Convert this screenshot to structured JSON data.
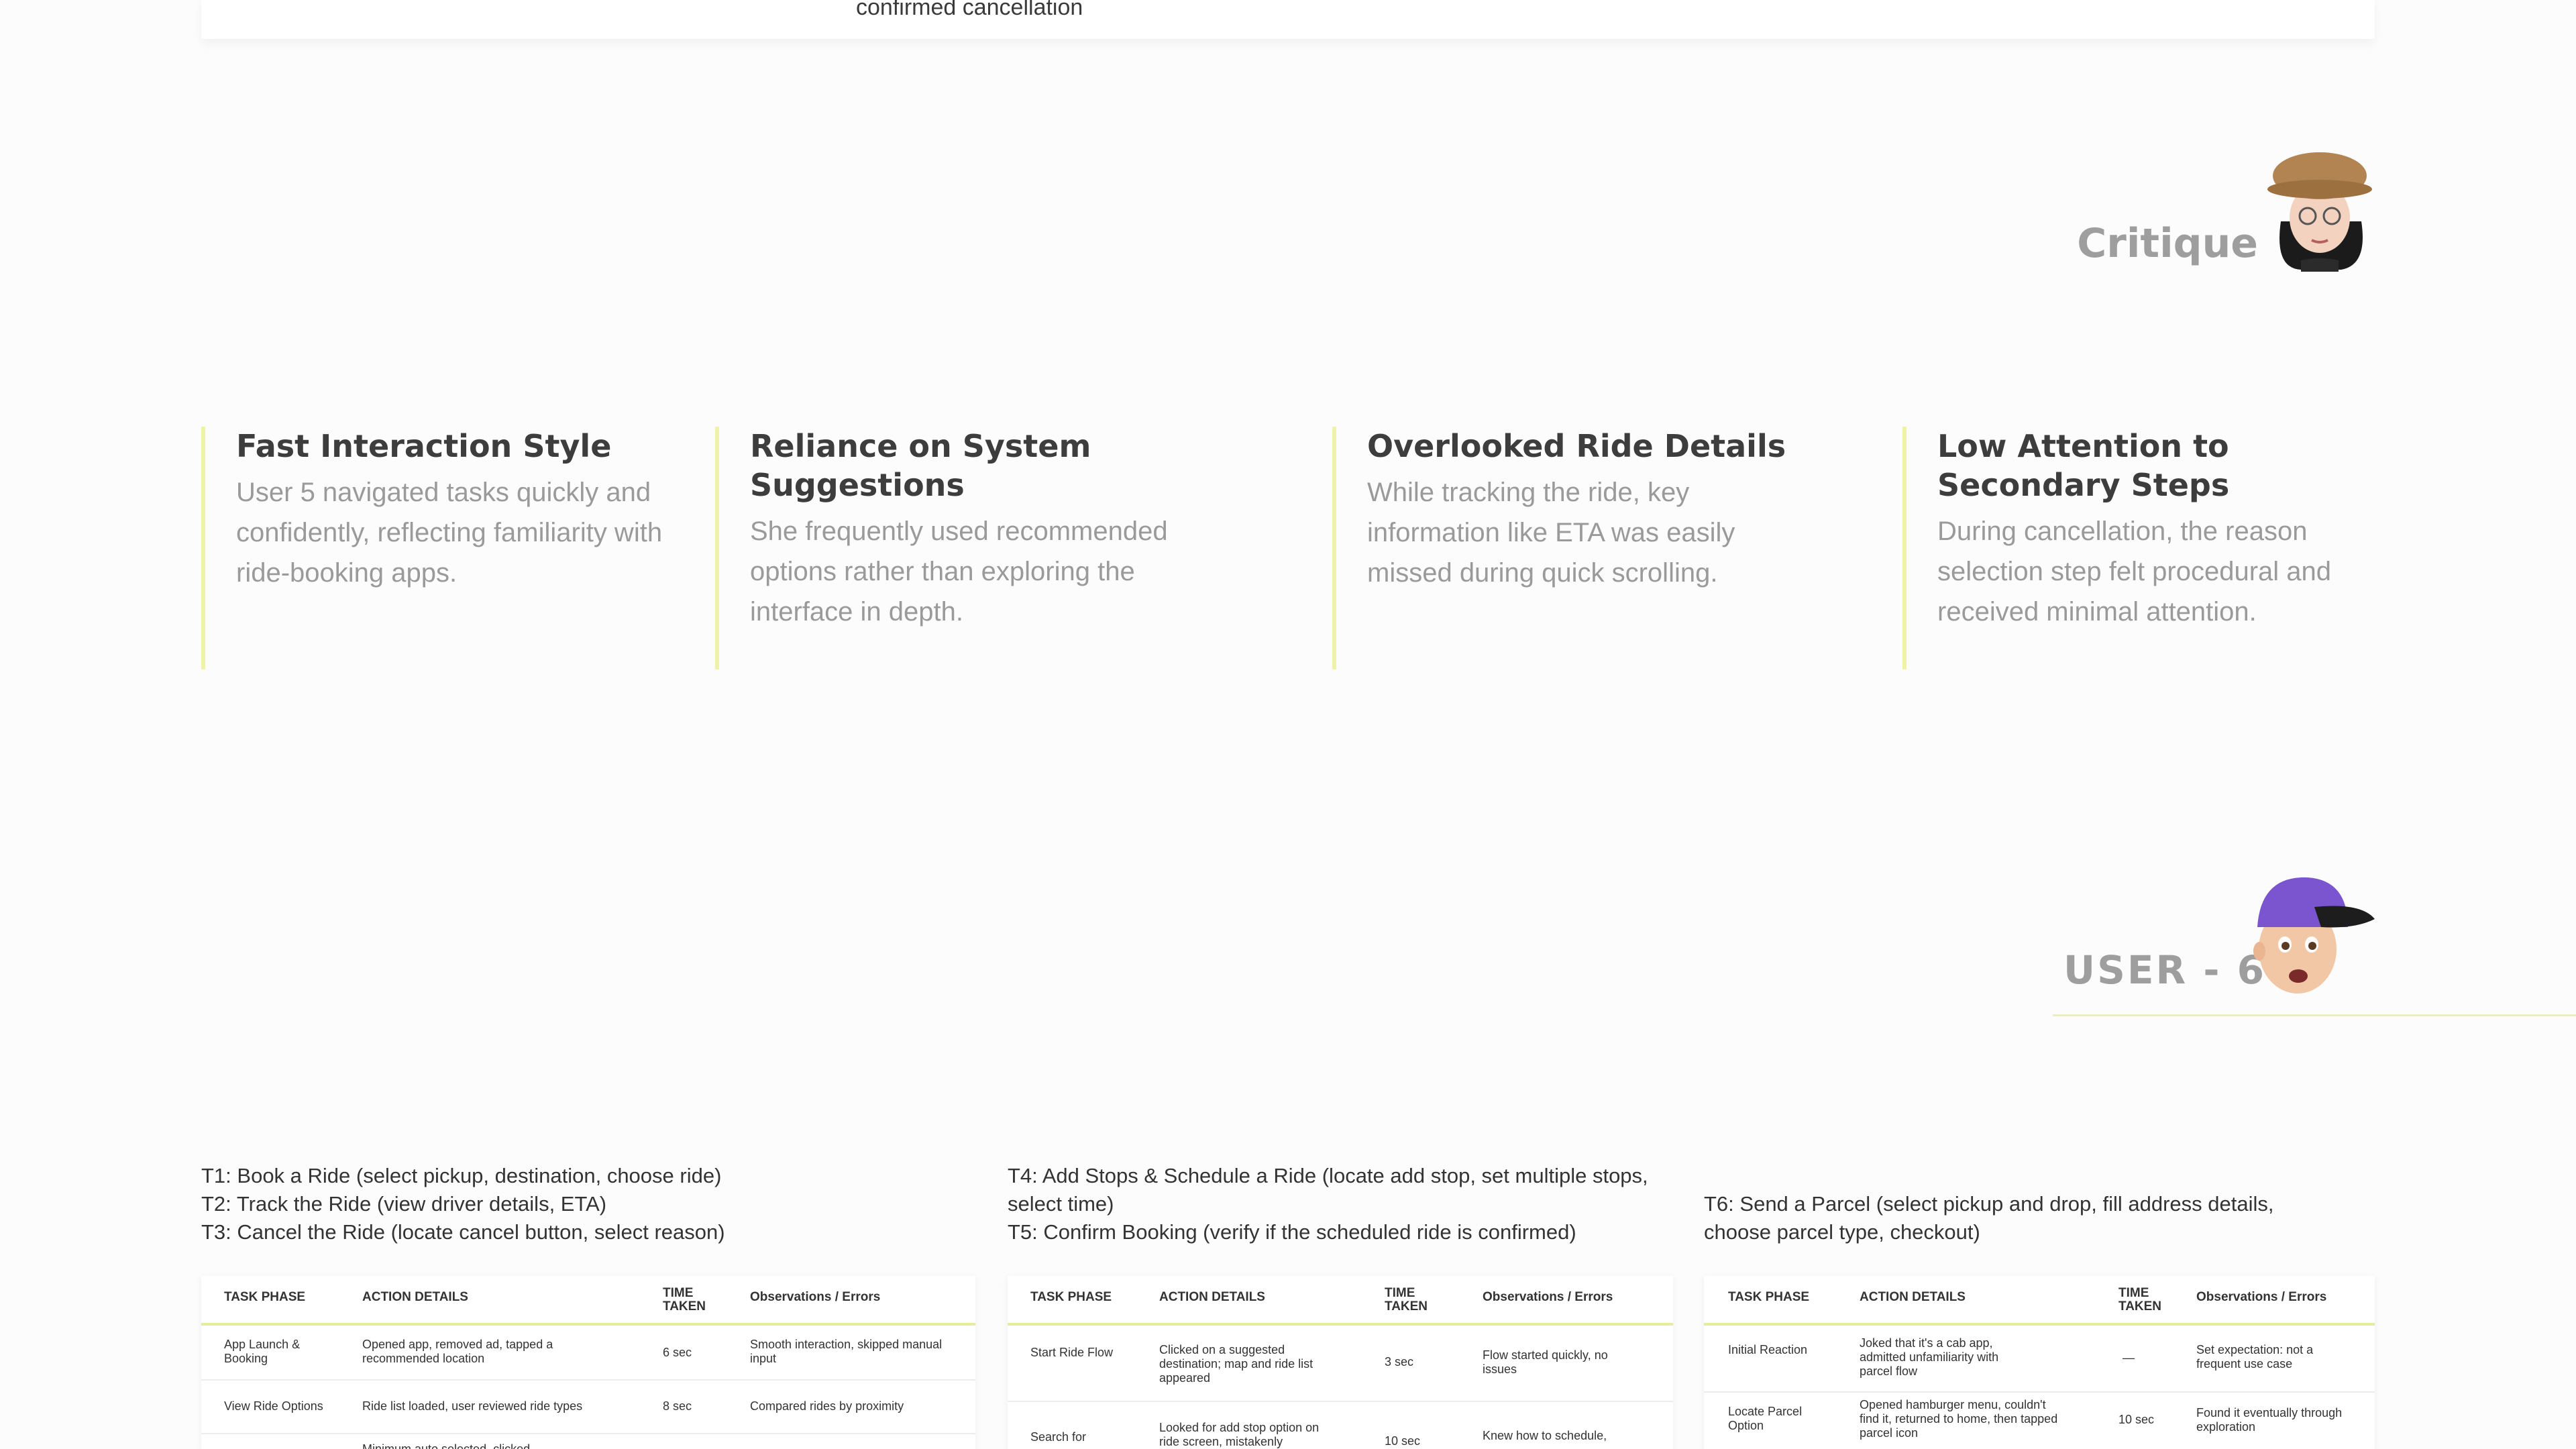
{
  "previous_card": {
    "text": "confirmed cancellation"
  },
  "critique": {
    "title": "Critique",
    "avatar_icon": "memoji-woman-hat-icon"
  },
  "insights": [
    {
      "title": "Fast Interaction Style",
      "body": "User 5 navigated tasks quickly and confidently, reflecting familiarity with ride-booking apps."
    },
    {
      "title": "Reliance on System Suggestions",
      "body": "She frequently used recommended options rather than exploring the interface in depth."
    },
    {
      "title": "Overlooked Ride Details",
      "body": "While tracking the ride, key information like ETA was easily missed during quick scrolling."
    },
    {
      "title": "Low Attention to Secondary Steps",
      "body": "During cancellation, the reason selection step felt procedural and received minimal attention."
    }
  ],
  "user_section": {
    "title": "USER - 6",
    "avatar_icon": "memoji-man-cap-icon"
  },
  "task_groups": [
    {
      "lines": [
        "T1: Book a Ride (select pickup, destination, choose ride)",
        "T2: Track the Ride (view driver details, ETA)",
        "T3: Cancel the Ride (locate cancel button, select reason)"
      ],
      "headers": [
        "TASK PHASE",
        "ACTION DETAILS",
        "TIME TAKEN",
        "Observations / Errors"
      ],
      "rows": [
        [
          "App Launch & Booking",
          "Opened app, removed ad, tapped a recommended location",
          "6 sec",
          "Smooth interaction, skipped manual input"
        ],
        [
          "View Ride Options",
          "Ride list loaded, user reviewed ride types",
          "8 sec",
          "Compared rides by proximity"
        ],
        [
          "",
          "Minimum auto selected, clicked",
          "",
          ""
        ]
      ]
    },
    {
      "lines": [
        "T4: Add Stops & Schedule a Ride (locate add stop, set multiple stops, select time)",
        "T5: Confirm Booking (verify if the scheduled ride is confirmed)"
      ],
      "headers": [
        "TASK PHASE",
        "ACTION DETAILS",
        "TIME TAKEN",
        "Observations / Errors"
      ],
      "rows": [
        [
          "Start Ride Flow",
          "Clicked on a suggested destination; map and ride list appeared",
          "3 sec",
          "Flow started quickly, no issues"
        ],
        [
          "Search for",
          "Looked for add stop option on ride screen, mistakenly",
          "10 sec",
          "Knew how to schedule,"
        ]
      ]
    },
    {
      "lines": [
        "T6: Send a Parcel (select pickup and drop, fill address details, choose parcel type, checkout)"
      ],
      "headers": [
        "TASK PHASE",
        "ACTION DETAILS",
        "TIME TAKEN",
        "Observations / Errors"
      ],
      "rows": [
        [
          "Initial Reaction",
          "Joked that it's a cab app, admitted unfamiliarity with parcel flow",
          "—",
          "Set expectation: not a frequent use case"
        ],
        [
          "Locate Parcel Option",
          "Opened hamburger menu, couldn't find it, returned to home, then tapped parcel icon",
          "10 sec",
          "Found it eventually through exploration"
        ]
      ]
    }
  ]
}
